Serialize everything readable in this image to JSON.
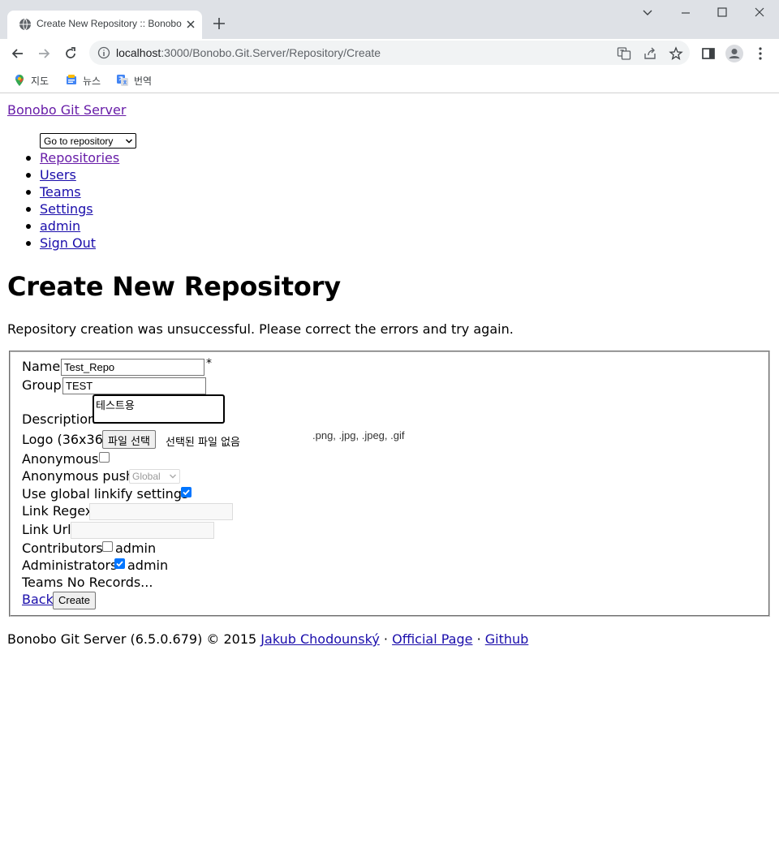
{
  "browser": {
    "tab_title": "Create New Repository :: Bonobo Git Server",
    "url_host": "localhost",
    "url_path": ":3000/Bonobo.Git.Server/Repository/Create",
    "bookmarks": [
      {
        "label": "지도",
        "icon": "maps-icon"
      },
      {
        "label": "뉴스",
        "icon": "news-icon"
      },
      {
        "label": "번역",
        "icon": "translate-icon"
      }
    ]
  },
  "header": {
    "brand": "Bonobo Git Server",
    "goto_select_value": "Go to repository"
  },
  "nav": {
    "items": [
      {
        "label": "Repositories",
        "visited": true
      },
      {
        "label": "Users"
      },
      {
        "label": "Teams"
      },
      {
        "label": "Settings"
      },
      {
        "label": "admin"
      },
      {
        "label": "Sign Out"
      }
    ]
  },
  "main": {
    "title": "Create New Repository",
    "error": "Repository creation was unsuccessful. Please correct the errors and try again."
  },
  "form": {
    "name_label": "Name",
    "name_value": "Test_Repo",
    "required_mark": "*",
    "group_label": "Group",
    "group_value": "TEST",
    "description_label": "Description",
    "description_value": "테스트용",
    "logo_label": "Logo (36x36)",
    "logo_button": "파일 선택",
    "logo_status": "선택된 파일 없음",
    "logo_hint": ".png, .jpg, .jpeg, .gif",
    "anonymous_label": "Anonymous",
    "anonymous_checked": false,
    "anonymous_push_label": "Anonymous push",
    "anonymous_push_value": "Global",
    "linkify_label": "Use global linkify settings",
    "linkify_checked": true,
    "link_regex_label": "Link Regex",
    "link_url_label": "Link Url",
    "contributors_label": "Contributors",
    "contributors_user": "admin",
    "contributors_checked": false,
    "administrators_label": "Administrators",
    "administrators_user": "admin",
    "administrators_checked": true,
    "teams_label": "Teams",
    "teams_value": "No Records...",
    "back_label": "Back",
    "create_label": "Create"
  },
  "footer": {
    "text": "Bonobo Git Server (6.5.0.679) © 2015",
    "author_link": "Jakub Chodounský",
    "separator": "·",
    "official_link": "Official Page",
    "github_link": "Github"
  },
  "colors": {
    "link": "#1a0dab",
    "visited_link": "#681da8",
    "checkbox_accent": "#0075ff",
    "chrome_bg": "#dee1e6"
  }
}
